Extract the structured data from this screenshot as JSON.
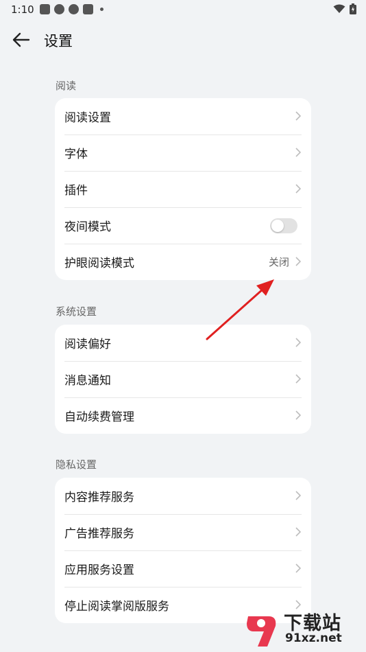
{
  "status": {
    "time": "1:10"
  },
  "header": {
    "title": "设置"
  },
  "sections": [
    {
      "label": "阅读",
      "items": [
        {
          "label": "阅读设置"
        },
        {
          "label": "字体"
        },
        {
          "label": "插件"
        },
        {
          "label": "夜间模式",
          "toggle": false
        },
        {
          "label": "护眼阅读模式",
          "value": "关闭"
        }
      ]
    },
    {
      "label": "系统设置",
      "items": [
        {
          "label": "阅读偏好"
        },
        {
          "label": "消息通知"
        },
        {
          "label": "自动续费管理"
        }
      ]
    },
    {
      "label": "隐私设置",
      "items": [
        {
          "label": "内容推荐服务"
        },
        {
          "label": "广告推荐服务"
        },
        {
          "label": "应用服务设置"
        },
        {
          "label": "停止阅读掌阅版服务"
        }
      ]
    }
  ],
  "watermark": {
    "name": "下载站",
    "url": "91xz.net"
  },
  "colors": {
    "background": "#f1f3f5",
    "card": "#ffffff",
    "annotation_arrow": "#e02020"
  }
}
